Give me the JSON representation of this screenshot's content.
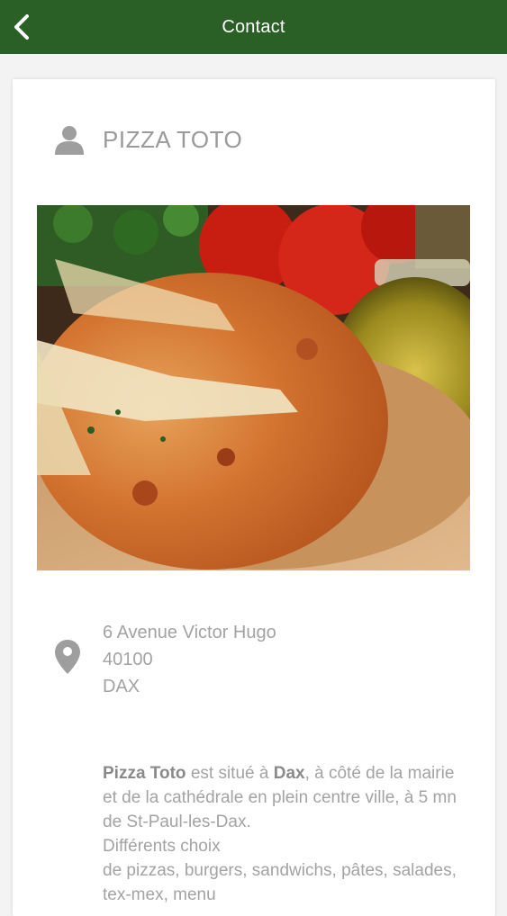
{
  "appbar": {
    "title": "Contact",
    "back_icon": "chevron-left-icon",
    "color": "#2a5f25"
  },
  "contact": {
    "name": "PIZZA TOTO",
    "person_icon": "person-icon",
    "photo_icon": "pizza-photo",
    "pin_icon": "map-pin-icon",
    "address": {
      "street": "6 Avenue Victor Hugo",
      "postcode": "40100",
      "city": "DAX"
    },
    "description": {
      "name_bold": "Pizza Toto",
      "text1": " est situé à ",
      "city_bold": "Dax",
      "text2": ", à côté de la mairie et de la cathédrale en plein centre ville, à 5 mn de St-Paul-les-Dax.",
      "line2": "Différents choix",
      "line3": "de pizzas, burgers, sandwichs, pâtes, salades, tex-mex, menu"
    }
  }
}
